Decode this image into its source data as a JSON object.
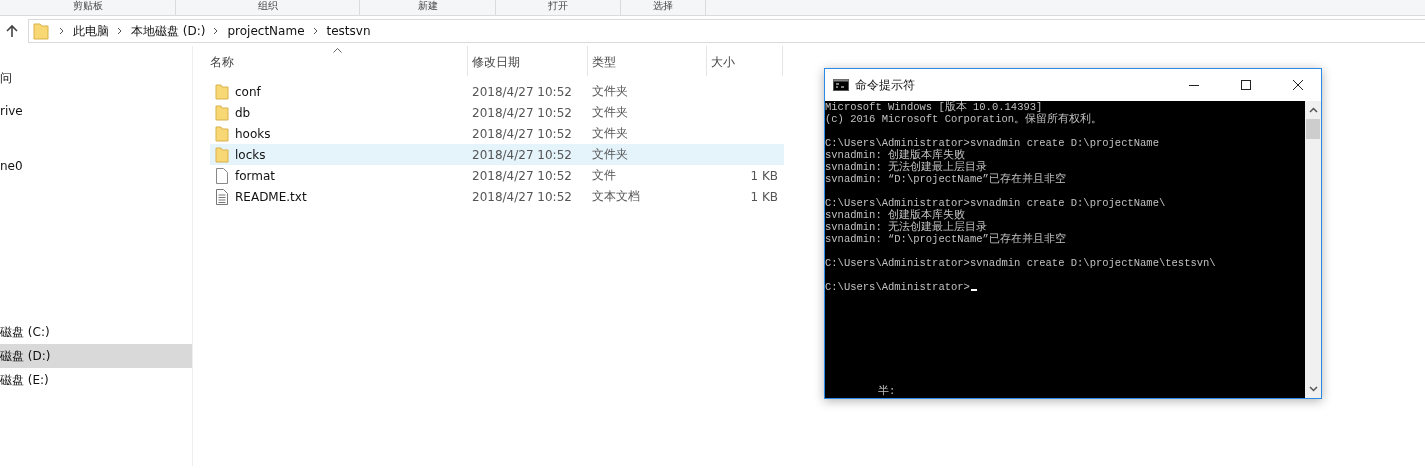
{
  "ribbon": {
    "groups": [
      "剪贴板",
      "组织",
      "新建",
      "打开",
      "选择"
    ]
  },
  "address_bar": {
    "path": [
      "此电脑",
      "本地磁盘 (D:)",
      "projectName",
      "testsvn"
    ]
  },
  "sidebar": {
    "items": [
      {
        "label": "问",
        "selected": false
      },
      {
        "label": "rive",
        "selected": false
      },
      {
        "label": "ne0",
        "selected": false
      }
    ],
    "drives": [
      {
        "label": "磁盘 (C:)",
        "selected": false
      },
      {
        "label": "磁盘 (D:)",
        "selected": true
      },
      {
        "label": "磁盘 (E:)",
        "selected": false
      }
    ]
  },
  "file_list": {
    "columns": [
      "名称",
      "修改日期",
      "类型",
      "大小"
    ],
    "rows": [
      {
        "kind": "folder",
        "name": "conf",
        "modified": "2018/4/27 10:52",
        "type": "文件夹",
        "selected": false
      },
      {
        "kind": "folder",
        "name": "db",
        "modified": "2018/4/27 10:52",
        "type": "文件夹",
        "selected": false
      },
      {
        "kind": "folder",
        "name": "hooks",
        "modified": "2018/4/27 10:52",
        "type": "文件夹",
        "selected": false
      },
      {
        "kind": "folder",
        "name": "locks",
        "modified": "2018/4/27 10:52",
        "type": "文件夹",
        "selected": true
      },
      {
        "kind": "file",
        "name": "format",
        "modified": "2018/4/27 10:52",
        "type": "文件",
        "size": "1 KB",
        "selected": false
      },
      {
        "kind": "text",
        "name": "README.txt",
        "modified": "2018/4/27 10:52",
        "type": "文本文档",
        "size": "1 KB",
        "selected": false
      }
    ]
  },
  "console_window": {
    "title": "命令提示符",
    "blocks": [
      [
        "Microsoft Windows [版本 10.0.14393]",
        "(c) 2016 Microsoft Corporation。保留所有权利。"
      ],
      [
        "C:\\Users\\Administrator>svnadmin create D:\\projectName",
        "svnadmin: 创建版本库失败",
        "svnadmin: 无法创建最上层目录",
        "svnadmin: “D:\\projectName”已存在并且非空"
      ],
      [
        "C:\\Users\\Administrator>svnadmin create D:\\projectName\\",
        "svnadmin: 创建版本库失败",
        "svnadmin: 无法创建最上层目录",
        "svnadmin: “D:\\projectName”已存在并且非空"
      ],
      [
        "C:\\Users\\Administrator>svnadmin create D:\\projectName\\testsvn\\"
      ]
    ],
    "prompt": "C:\\Users\\Administrator>",
    "ime_status": "半:"
  }
}
